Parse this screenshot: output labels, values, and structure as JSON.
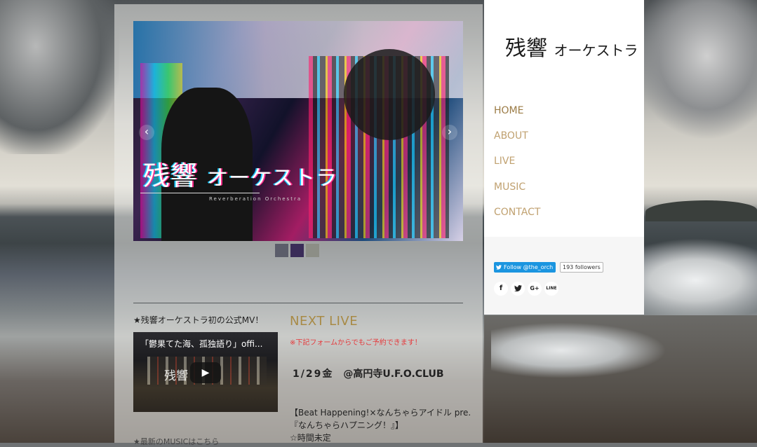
{
  "site": {
    "logo_text": "残響",
    "logo_kana": "オーケストラ"
  },
  "nav": [
    {
      "label": "HOME",
      "active": true
    },
    {
      "label": "ABOUT"
    },
    {
      "label": "LIVE"
    },
    {
      "label": "MUSIC"
    },
    {
      "label": "CONTACT"
    }
  ],
  "slider": {
    "logo_text": "残響",
    "logo_kana": "オーケストラ",
    "logo_sub": "Reverberation Orchestra",
    "prev_icon": "‹",
    "next_icon": "›",
    "thumb_colors": [
      "#5b5d6a",
      "#3a2c58",
      "#8c8e86"
    ]
  },
  "mv": {
    "heading": "★残響オーケストラ初の公式MV！",
    "video_title": "「鬱果てた海、孤独語り」offi...",
    "video_logo": "残響",
    "play_icon": "▶"
  },
  "live": {
    "heading": "NEXT LIVE",
    "notice": "※下記フォームからでもご予約できます！",
    "date": "1/29金",
    "venue": "@高円寺U.F.O.CLUB",
    "event_lines": [
      "【Beat Happening!×なんちゃらアイドル pre.",
      "『なんちゃらハプニング！』】",
      "☆時間未定"
    ]
  },
  "bottom_cut_text": "★最新のMUSICはこちら",
  "social": {
    "twitter_follow": "Follow @the_orch",
    "followers": "193 followers",
    "share_icons": [
      "f",
      "t",
      "G+",
      "LINE"
    ]
  },
  "colors": {
    "accent": "#a88a45",
    "nav": "#c0a170",
    "notice": "#e5393c",
    "twitter": "#1b95e0"
  }
}
